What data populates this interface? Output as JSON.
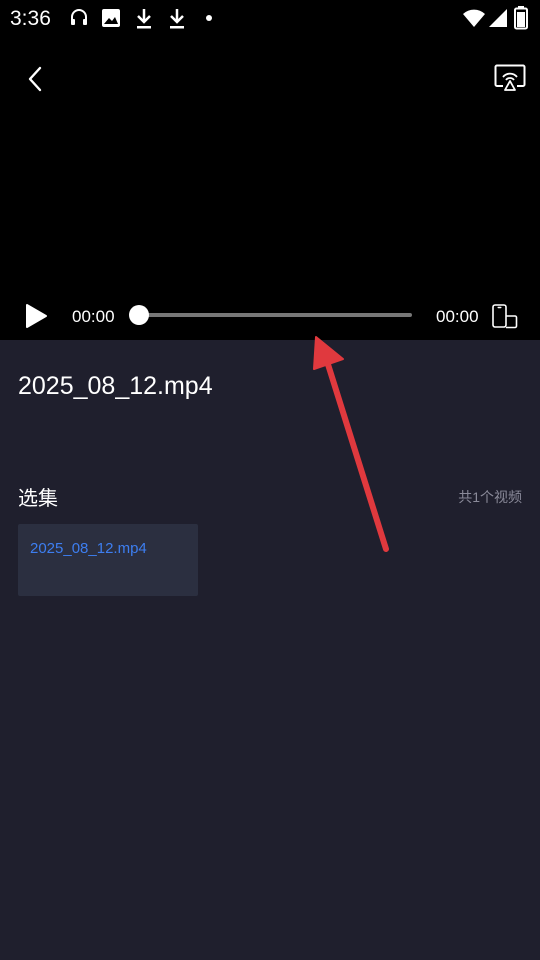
{
  "status_bar": {
    "time": "3:36",
    "icons": [
      "headphones-icon",
      "image-icon",
      "download-icon",
      "download-icon",
      "dot-icon",
      "wifi-icon",
      "signal-icon",
      "battery-icon"
    ]
  },
  "player": {
    "back_icon": "chevron-left-icon",
    "cast_icon": "screen-cast-icon",
    "play_icon": "play-icon",
    "current_time": "00:00",
    "total_time": "00:00",
    "progress": 0,
    "rotate_icon": "rotate-screen-icon"
  },
  "video": {
    "title": "2025_08_12.mp4"
  },
  "episodes": {
    "section_title": "选集",
    "count_text": "共1个视频",
    "items": [
      {
        "label": "2025_08_12.mp4"
      }
    ]
  },
  "colors": {
    "page_bg": "#1f1f2d",
    "player_bg": "#000000",
    "episode_bg": "#2b2f40",
    "accent": "#3d7ef0",
    "annotation": "#e0393e"
  }
}
